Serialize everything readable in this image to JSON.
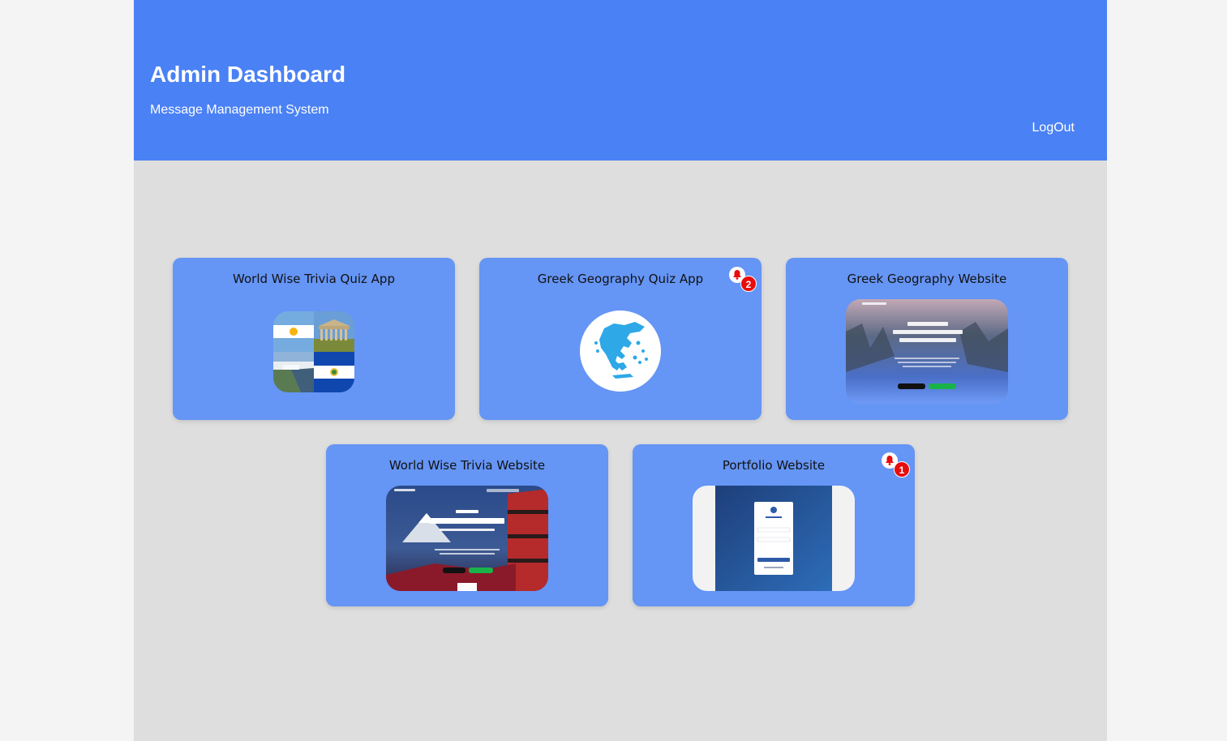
{
  "header": {
    "title": "Admin Dashboard",
    "subtitle": "Message Management System",
    "logout_label": "LogOut"
  },
  "colors": {
    "header_bg": "#4a81f5",
    "card_bg": "#6595f5",
    "badge": "#e80d0d",
    "content_bg": "#dedede"
  },
  "apps": [
    {
      "title": "World Wise Trivia Quiz App",
      "thumbnail": "flags-collage-icon",
      "notifications": null
    },
    {
      "title": "Greek Geography Quiz App",
      "thumbnail": "greece-map-icon",
      "notifications": "2"
    },
    {
      "title": "Greek Geography Website",
      "thumbnail": "website-screenshot",
      "notifications": null
    },
    {
      "title": "World Wise Trivia Website",
      "thumbnail": "website-screenshot",
      "notifications": null
    },
    {
      "title": "Portfolio Website",
      "thumbnail": "login-screenshot",
      "notifications": "1"
    }
  ]
}
